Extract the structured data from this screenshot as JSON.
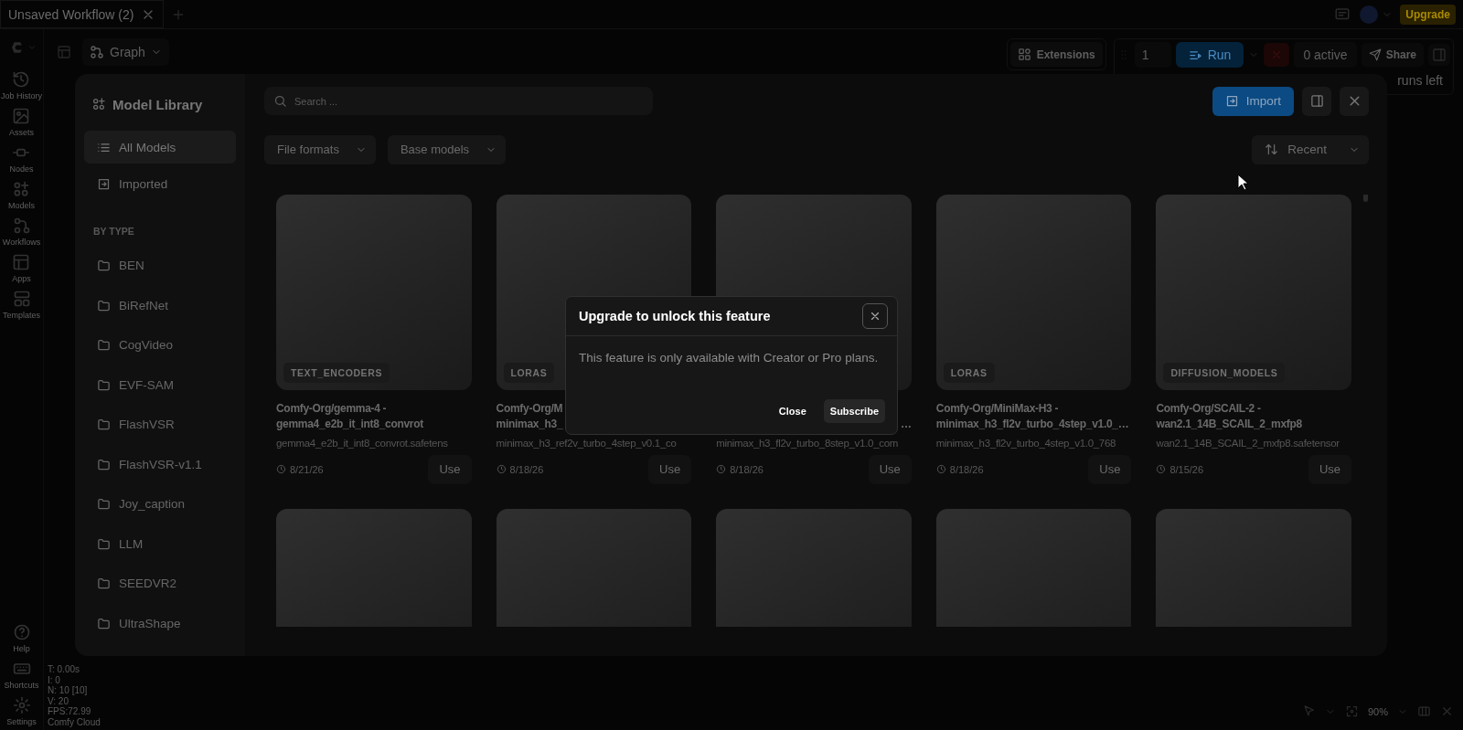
{
  "tabs": [
    {
      "label": "Unsaved Workflow (2)",
      "selected": true
    }
  ],
  "topbar": {
    "upgrade": "Upgrade"
  },
  "rail": {
    "top": [
      "Job History",
      "Assets",
      "Nodes",
      "Models",
      "Workflows",
      "Apps",
      "Templates"
    ],
    "bottom": [
      "Help",
      "Shortcuts",
      "Settings"
    ]
  },
  "toolbar": {
    "view": "Graph",
    "extensions": "Extensions",
    "batch": "1",
    "run": "Run",
    "active": "0 active",
    "share": "Share",
    "runs_left": "runs left"
  },
  "stats": [
    "T: 0.00s",
    "I: 0",
    "N: 10 [10]",
    "V: 20",
    "FPS:72.99",
    "Comfy Cloud"
  ],
  "zoom_level": "90%",
  "library": {
    "title": "Model Library",
    "nav": [
      {
        "label": "All Models",
        "selected": true
      },
      {
        "label": "Imported",
        "selected": false
      }
    ],
    "section": "BY TYPE",
    "folders": [
      "BEN",
      "BiRefNet",
      "CogVideo",
      "EVF-SAM",
      "FlashVSR",
      "FlashVSR-v1.1",
      "Joy_caption",
      "LLM",
      "SEEDVR2",
      "UltraShape"
    ],
    "search": {
      "placeholder": "Search ..."
    },
    "import": "Import",
    "filters": [
      "File formats",
      "Base models"
    ],
    "sort": "Recent",
    "cards": [
      {
        "kind": "full",
        "badge": "TEXT_ENCODERS",
        "title_lines": [
          "Comfy-Org/gemma-4 -",
          "gemma4_e2b_it_int8_convrot"
        ],
        "filename": "gemma4_e2b_it_int8_convrot.safetens",
        "date": "8/21/26",
        "action": "Use"
      },
      {
        "kind": "full",
        "badge": "LORAS",
        "title_lines": [
          "Comfy-Org/M",
          "minimax_h3_"
        ],
        "filename": "minimax_h3_ref2v_turbo_4step_v0.1_co",
        "date": "8/18/26",
        "action": "Use"
      },
      {
        "kind": "full",
        "title_lines": [
          "…"
        ],
        "filename": "minimax_h3_fl2v_turbo_8step_v1.0_com",
        "date": "8/18/26",
        "action": "Use"
      },
      {
        "kind": "full",
        "badge": "LORAS",
        "title_lines": [
          "Comfy-Org/MiniMax-H3 -",
          "minimax_h3_fl2v_turbo_4step_v1.0_…"
        ],
        "filename": "minimax_h3_fl2v_turbo_4step_v1.0_768",
        "date": "8/18/26",
        "action": "Use"
      },
      {
        "kind": "full",
        "badge": "DIFFUSION_MODELS",
        "title_lines": [
          "Comfy-Org/SCAIL-2 -",
          "wan2.1_14B_SCAIL_2_mxfp8"
        ],
        "filename": "wan2.1_14B_SCAIL_2_mxfp8.safetensor",
        "date": "8/15/26",
        "action": "Use"
      },
      {
        "kind": "thumb"
      },
      {
        "kind": "thumb"
      },
      {
        "kind": "thumb"
      },
      {
        "kind": "thumb"
      },
      {
        "kind": "thumb"
      }
    ]
  },
  "dialog": {
    "title": "Upgrade to unlock this feature",
    "message": "This feature is only available with Creator or Pro plans.",
    "buttons": [
      {
        "label": "Close",
        "kind": "text"
      },
      {
        "label": "Subscribe",
        "kind": "filled"
      }
    ]
  }
}
